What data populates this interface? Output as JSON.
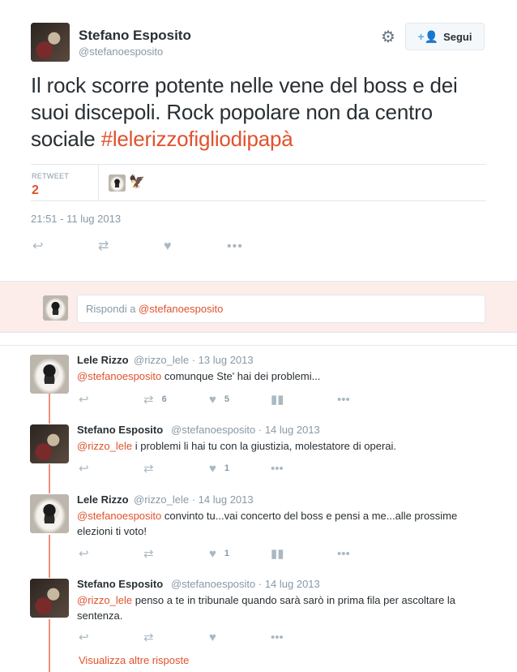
{
  "tweet": {
    "author_name": "Stefano Esposito",
    "author_handle": "@stefanoesposito",
    "follow_label": "Segui",
    "text_main": "Il rock scorre potente nelle vene del boss e dei suoi discepoli. Rock popolare non da centro sociale ",
    "hashtag": "#lelerizzofigliodipapà",
    "retweet_label": "RETWEET",
    "retweet_count": "2",
    "timestamp": "21:51 - 11 lug 2013"
  },
  "reply_box": {
    "prefix": "Rispondi a ",
    "mention": "@stefanoesposito"
  },
  "replies": [
    {
      "name": "Lele Rizzo",
      "meta": "@rizzo_lele · 13 lug 2013",
      "mention": "@stefanoesposito",
      "text": " comunque Ste' hai dei problemi...",
      "retweets": "6",
      "likes": "5"
    },
    {
      "name": "Stefano Esposito",
      "meta": "@stefanoesposito · 14 lug 2013",
      "mention": "@rizzo_lele",
      "text": " i problemi li hai tu con la giustizia, molestatore di operai.",
      "retweets": "",
      "likes": "1"
    },
    {
      "name": "Lele Rizzo",
      "meta": "@rizzo_lele · 14 lug 2013",
      "mention": "@stefanoesposito",
      "text": " convinto tu...vai concerto del boss e pensi a me...alle prossime elezioni ti voto!",
      "retweets": "",
      "likes": "1"
    },
    {
      "name": "Stefano Esposito",
      "meta": "@stefanoesposito · 14 lug 2013",
      "mention": "@rizzo_lele",
      "text": " penso a te in tribunale quando sarà sarò in prima fila per ascoltare la sentenza.",
      "retweets": "",
      "likes": ""
    }
  ],
  "more_replies_label": "Visualizza altre risposte",
  "icons": {
    "reply": "reply-icon",
    "retweet": "retweet-icon",
    "like": "heart-icon",
    "analytics": "analytics-icon",
    "more": "more-icon",
    "settings": "gear-icon",
    "follow": "follow-user-icon"
  },
  "colors": {
    "accent": "#e0522c",
    "reply_band": "#fcecea",
    "thread_line": "#ef8f7a"
  }
}
